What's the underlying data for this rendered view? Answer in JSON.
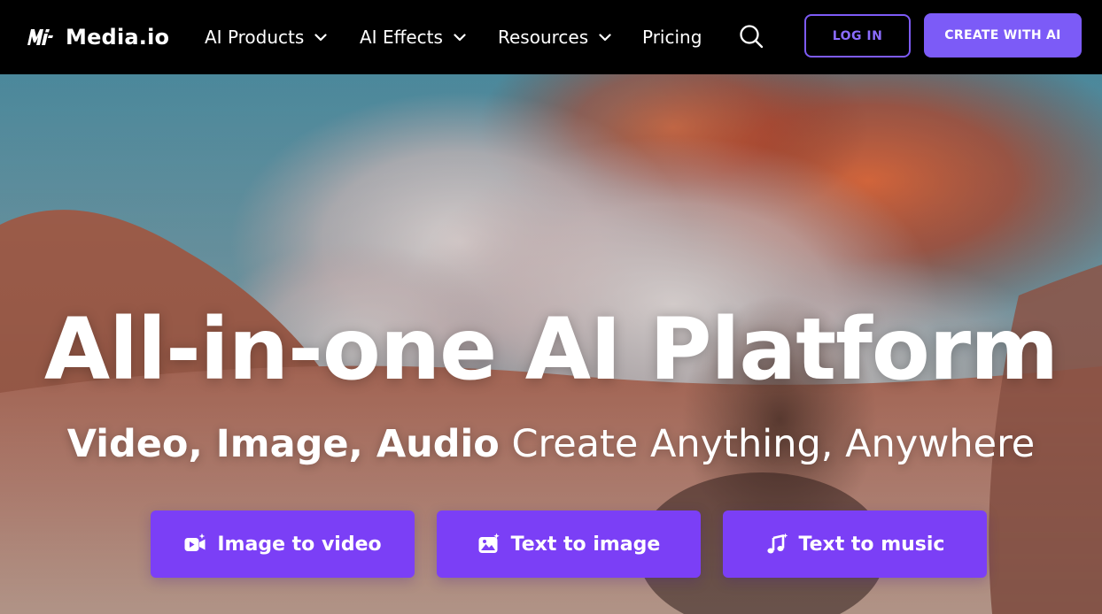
{
  "brand": {
    "name": "Media.io",
    "logo_icon": "mi-logo-icon"
  },
  "nav": {
    "items": [
      {
        "label": "AI Products",
        "has_dropdown": true
      },
      {
        "label": "AI Effects",
        "has_dropdown": true
      },
      {
        "label": "Resources",
        "has_dropdown": true
      },
      {
        "label": "Pricing",
        "has_dropdown": false
      }
    ],
    "search_icon": "search-icon"
  },
  "auth": {
    "login_label": "LOG IN",
    "create_label": "CREATE WITH AI"
  },
  "hero": {
    "title": "All-in-one AI Platform",
    "subtitle_strong": "Video, Image, Audio",
    "subtitle_light": "Create Anything, Anywhere"
  },
  "cta_buttons": [
    {
      "label": "Image to video",
      "icon": "image-to-video-icon"
    },
    {
      "label": "Text to image",
      "icon": "text-to-image-icon"
    },
    {
      "label": "Text to music",
      "icon": "music-note-icon"
    }
  ],
  "colors": {
    "nav_bg": "#000000",
    "accent": "#7c5bf7",
    "login_border": "#7d5bf5",
    "cta_bg": "#7b3ff6",
    "text": "#ffffff"
  }
}
